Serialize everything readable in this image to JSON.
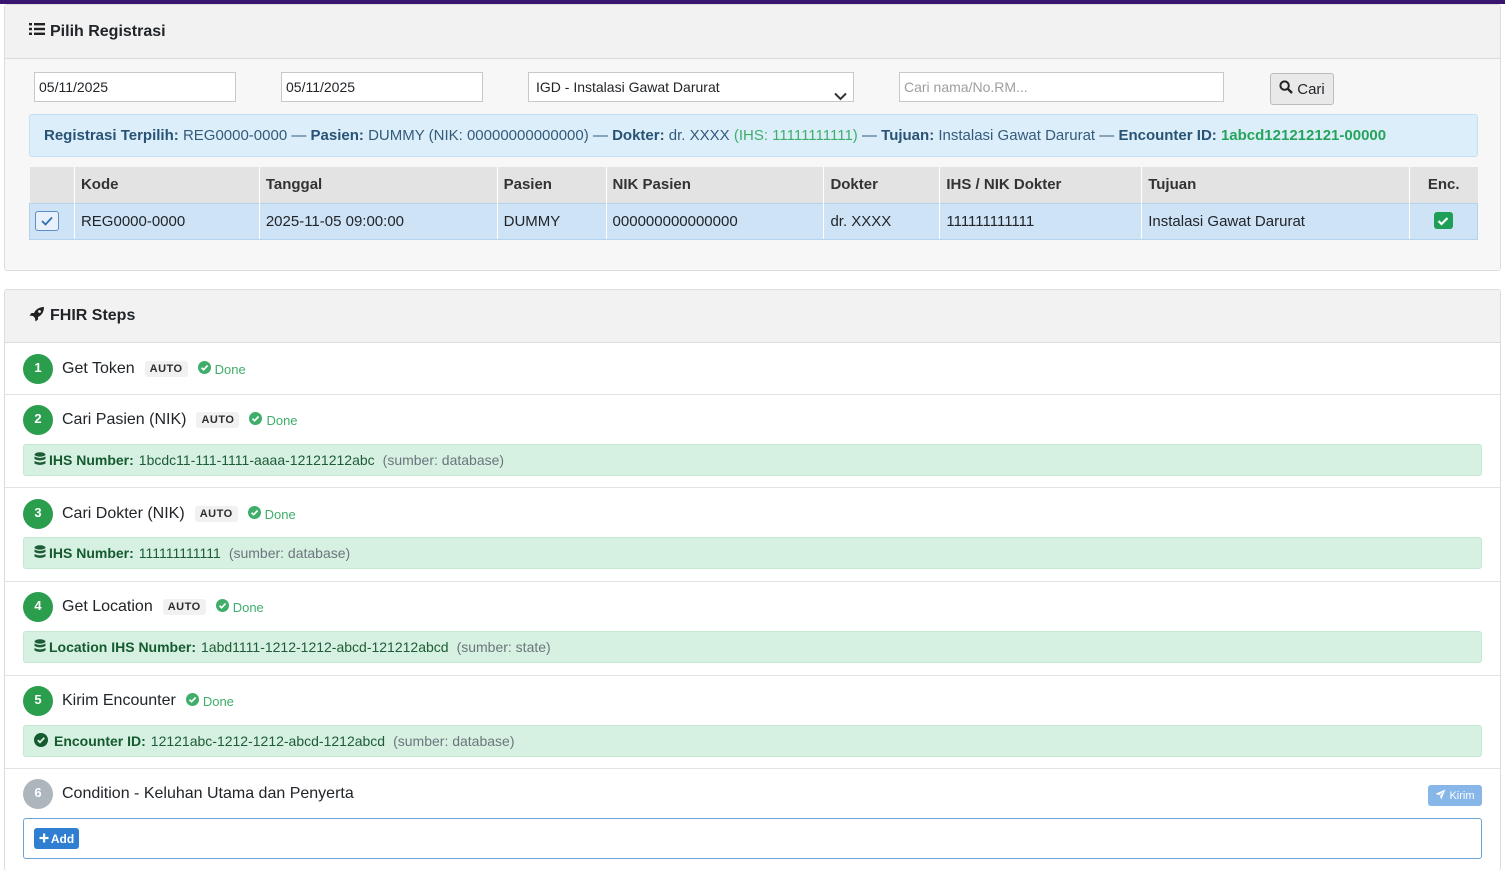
{
  "registrasi_card": {
    "title": "Pilih Registrasi",
    "filters": {
      "date_from": "05/11/2025",
      "date_to": "05/11/2025",
      "unit_selected": "IGD - Instalasi Gawat Darurat",
      "search_placeholder": "Cari nama/No.RM...",
      "search_button": "Cari"
    },
    "selected_info": {
      "reg_label": "Registrasi Terpilih:",
      "reg_value": "REG0000-0000",
      "sep1": "—",
      "pasien_label": "Pasien:",
      "pasien_value": "DUMMY (NIK: 00000000000000)",
      "sep2": "—",
      "dokter_label": "Dokter:",
      "dokter_value": "dr. XXXX",
      "dokter_ihs": "(IHS: 11111111111)",
      "sep3": "—",
      "tujuan_label": "Tujuan:",
      "tujuan_value": "Instalasi Gawat Darurat",
      "sep4": "—",
      "encounter_label": "Encounter ID:",
      "encounter_value": "1abcd121212121-00000"
    },
    "table": {
      "headers": [
        "",
        "Kode",
        "Tanggal",
        "Pasien",
        "NIK Pasien",
        "Dokter",
        "IHS / NIK Dokter",
        "Tujuan",
        "Enc."
      ],
      "rows": [
        {
          "kode": "REG0000-0000",
          "tanggal": "2025-11-05 09:00:00",
          "pasien": "DUMMY",
          "nik_pasien": "000000000000000",
          "dokter": "dr. XXXX",
          "ihs_dokter": "111111111111",
          "tujuan": "Instalasi Gawat Darurat"
        }
      ]
    }
  },
  "fhir_card": {
    "title": "FHIR Steps",
    "done_label": "Done",
    "auto_label": "AUTO",
    "steps": [
      {
        "num": "1",
        "title": "Get Token"
      },
      {
        "num": "2",
        "title": "Cari Pasien (NIK)",
        "result_label": "IHS Number:",
        "result_value": "1bcdc11-111-1111-aaaa-12121212abc",
        "result_source": "(sumber: database)"
      },
      {
        "num": "3",
        "title": "Cari Dokter (NIK)",
        "result_label": "IHS Number:",
        "result_value": "111111111111",
        "result_source": "(sumber: database)"
      },
      {
        "num": "4",
        "title": "Get Location",
        "result_label": "Location IHS Number:",
        "result_value": "1abd1111-1212-1212-abcd-121212abcd",
        "result_source": "(sumber: state)"
      },
      {
        "num": "5",
        "title": "Kirim Encounter",
        "result_label": "Encounter ID:",
        "result_value": "12121abc-1212-1212-abcd-1212abcd",
        "result_source": "(sumber: database)"
      },
      {
        "num": "6",
        "title": "Condition - Keluhan Utama dan Penyerta",
        "send_button": "Kirim",
        "add_button": "Add"
      }
    ]
  },
  "colors": {
    "accent_topbar": "#3b1670",
    "done_green": "#3fae6a",
    "step_green": "#2a9e4d",
    "pending_grey": "#adb5bd",
    "primary_blue": "#2f7ed1"
  }
}
